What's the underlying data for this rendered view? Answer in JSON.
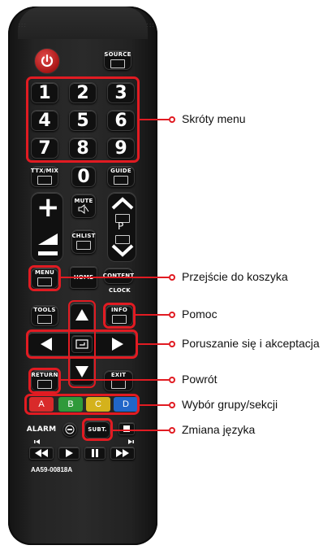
{
  "buttons": {
    "source": "SOURCE",
    "numbers": [
      "1",
      "2",
      "3",
      "4",
      "5",
      "6",
      "7",
      "8",
      "9",
      "0"
    ],
    "ttx": "TTX/MIX",
    "guide": "GUIDE",
    "vol_plus": "+",
    "mute": "MUTE",
    "ch_p": "P",
    "chlist": "CHLIST",
    "menu": "MENU",
    "home": "HOME",
    "content": "CONTENT",
    "clock": "CLOCK",
    "tools": "TOOLS",
    "info": "INFO",
    "return": "RETURN",
    "exit": "EXIT",
    "colors": [
      "A",
      "B",
      "C",
      "D"
    ],
    "alarm": "ALARM",
    "subt": "SUBT."
  },
  "model": "AA59-00818A",
  "callouts": [
    "Skróty menu",
    "Przejście do koszyka",
    "Pomoc",
    "Poruszanie się i akceptacja",
    "Powrót",
    "Wybór grupy/sekcji",
    "Zmiana języka"
  ],
  "colors": {
    "accent": "#e11b22",
    "a": "#d92a2a",
    "b": "#2f9a3a",
    "c": "#d4b21c",
    "d": "#2166c8"
  }
}
